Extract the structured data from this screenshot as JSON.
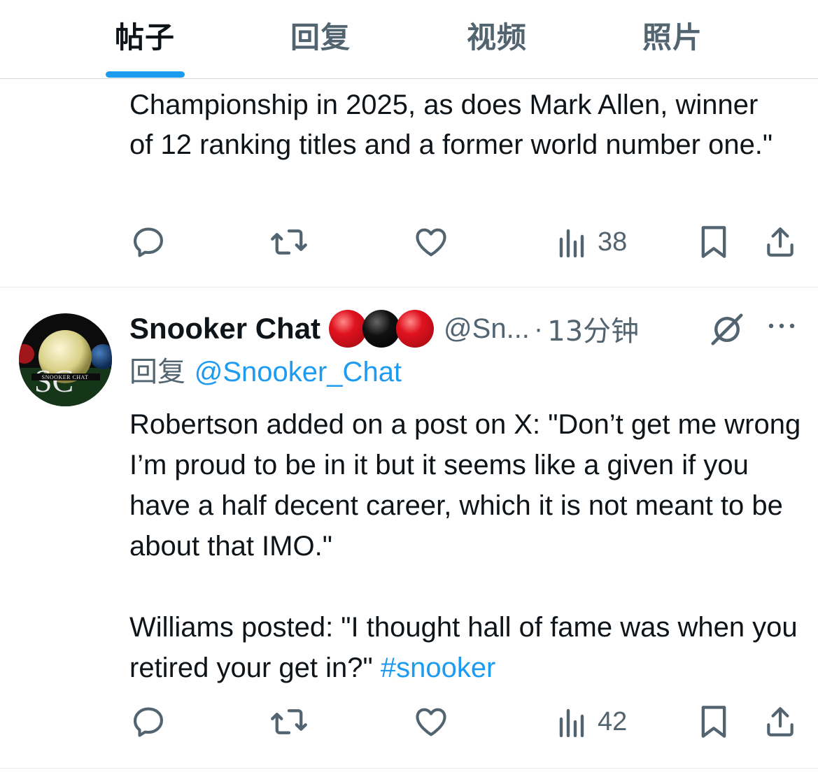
{
  "tabs": [
    {
      "label": "帖子",
      "active": true
    },
    {
      "label": "回复",
      "active": false
    },
    {
      "label": "视频",
      "active": false
    },
    {
      "label": "照片",
      "active": false
    }
  ],
  "previous_post": {
    "text": "Championship in 2025, as does Mark Allen, winner of 12 ranking titles and a former world number one.\"",
    "views": "38"
  },
  "post": {
    "author_name": "Snooker Chat",
    "author_emoji": [
      "red-ball",
      "black-ball",
      "red-ball"
    ],
    "handle": "@Sn...",
    "separator": "·",
    "time": "13分钟",
    "reply_prefix": "回复",
    "reply_mention": "@Snooker_Chat",
    "paragraph1": "Robertson added on a post on X: \"Don’t get me wrong I’m proud to be in it but it seems like a given if you have a half decent career, which it is not meant to be about that IMO.\"",
    "paragraph2_text": "Williams posted: \"I thought hall of fame was when you retired your get in?\" ",
    "hashtag": "#snooker",
    "views": "42",
    "avatar_text": "SC",
    "avatar_subtext": "SNOOKER CHAT"
  },
  "colors": {
    "accent": "#1d9bf0",
    "text": "#0f1419",
    "muted": "#536471",
    "red_ball": "#e0121f",
    "black_ball": "#111111"
  }
}
